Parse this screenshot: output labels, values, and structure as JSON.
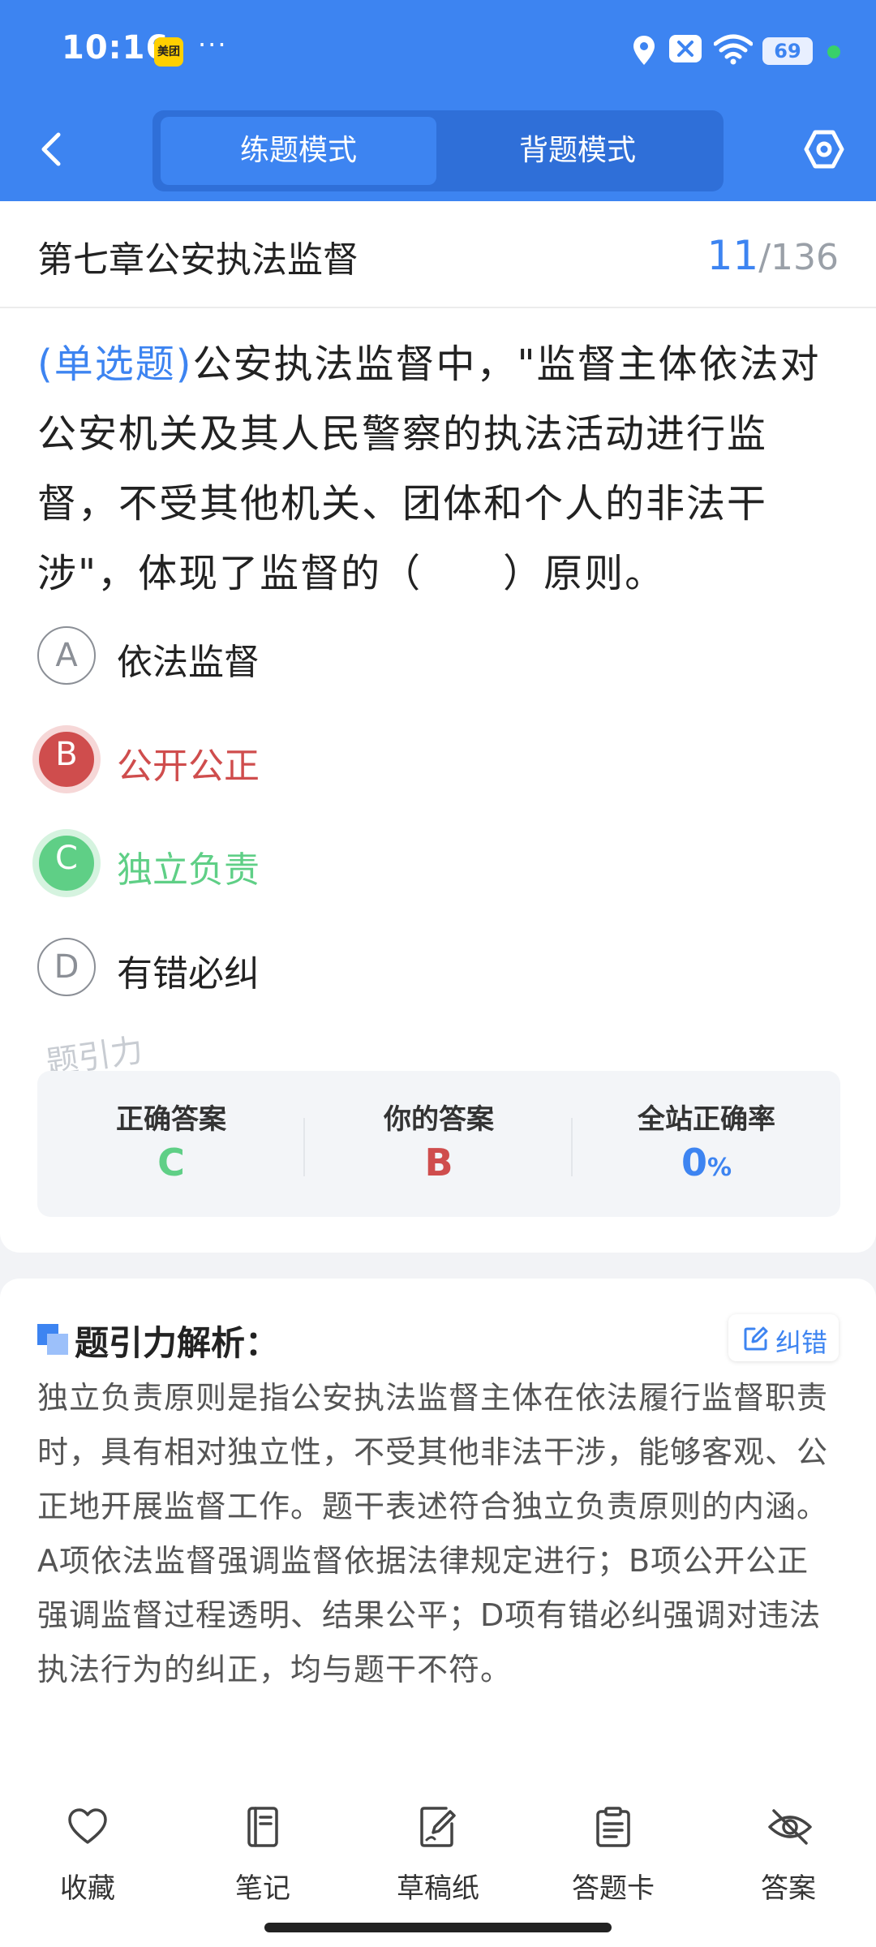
{
  "status_bar": {
    "time": "10:16",
    "app_badge": "美团",
    "more_dots": "···",
    "battery": "69",
    "icons": [
      "location-icon",
      "close-box-icon",
      "wifi-icon",
      "battery-icon"
    ]
  },
  "nav": {
    "tabs": [
      {
        "label": "练题模式",
        "active": true
      },
      {
        "label": "背题模式",
        "active": false
      }
    ]
  },
  "question": {
    "chapter": "第七章公安执法监督",
    "current": "11",
    "total": "/136",
    "type": "(单选题)",
    "text": "公安执法监督中，\"监督主体依法对公安机关及其人民警察的执法活动进行监督，不受其他机关、团体和个人的非法干涉\"，体现了监督的（　　）原则。",
    "options": [
      {
        "key": "A",
        "text": "依法监督",
        "state": "normal"
      },
      {
        "key": "B",
        "text": "公开公正",
        "state": "wrong"
      },
      {
        "key": "C",
        "text": "独立负责",
        "state": "right"
      },
      {
        "key": "D",
        "text": "有错必纠",
        "state": "normal"
      }
    ],
    "watermark": "题引力"
  },
  "stats": {
    "correct_label": "正确答案",
    "correct_value": "C",
    "yours_label": "你的答案",
    "yours_value": "B",
    "rate_label": "全站正确率",
    "rate_value": "0",
    "rate_unit": "%"
  },
  "analysis": {
    "title": "题引力解析：",
    "correct_button": "纠错",
    "text": "独立负责原则是指公安执法监督主体在依法履行监督职责时，具有相对独立性，不受其他非法干涉，能够客观、公正地开展监督工作。题干表述符合独立负责原则的内涵。A项依法监督强调监督依据法律规定进行；B项公开公正强调监督过程透明、结果公平；D项有错必纠强调对违法执法行为的纠正，均与题干不符。"
  },
  "bottom_bar": {
    "items": [
      {
        "label": "收藏",
        "icon": "heart-icon"
      },
      {
        "label": "笔记",
        "icon": "notebook-icon"
      },
      {
        "label": "草稿纸",
        "icon": "draft-icon"
      },
      {
        "label": "答题卡",
        "icon": "answer-card-icon"
      },
      {
        "label": "答案",
        "icon": "eye-off-icon"
      }
    ]
  },
  "colors": {
    "brand": "#3d84f1",
    "wrong": "#cf4d4d",
    "right": "#5fcf86"
  }
}
